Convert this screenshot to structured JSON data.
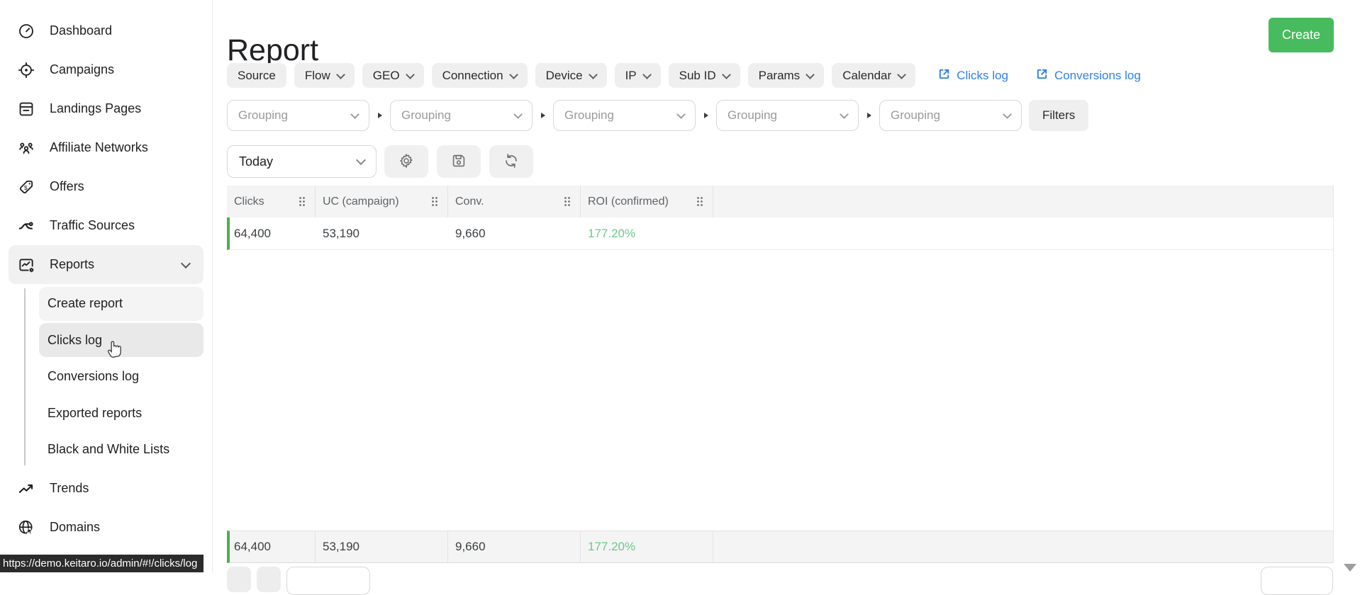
{
  "app": {
    "accent_green": "#47bb5e",
    "link_blue": "#2e80ec",
    "roi_green": "#6dc98a",
    "row_marker_green": "#4caf50"
  },
  "sidebar": {
    "items": [
      {
        "label": "Dashboard",
        "icon": "dashboard-gauge-icon"
      },
      {
        "label": "Campaigns",
        "icon": "target-icon"
      },
      {
        "label": "Landings Pages",
        "icon": "document-icon"
      },
      {
        "label": "Affiliate Networks",
        "icon": "people-icon"
      },
      {
        "label": "Offers",
        "icon": "price-tag-icon"
      },
      {
        "label": "Traffic Sources",
        "icon": "branch-icon"
      },
      {
        "label": "Reports",
        "icon": "report-chart-gear-icon",
        "expanded": true
      },
      {
        "label": "Trends",
        "icon": "trending-up-icon"
      },
      {
        "label": "Domains",
        "icon": "globe-cursor-icon"
      }
    ],
    "reports_children": [
      {
        "label": "Create report",
        "selected": true
      },
      {
        "label": "Clicks log",
        "hovered": true
      },
      {
        "label": "Conversions log"
      },
      {
        "label": "Exported reports"
      },
      {
        "label": "Black and White Lists"
      }
    ]
  },
  "header": {
    "title": "Report",
    "create_button": "Create"
  },
  "filter_bar": {
    "chips": [
      {
        "label": "Source",
        "chevron": false
      },
      {
        "label": "Flow",
        "chevron": true
      },
      {
        "label": "GEO",
        "chevron": true
      },
      {
        "label": "Connection",
        "chevron": true
      },
      {
        "label": "Device",
        "chevron": true
      },
      {
        "label": "IP",
        "chevron": true
      },
      {
        "label": "Sub ID",
        "chevron": true
      },
      {
        "label": "Params",
        "chevron": true
      },
      {
        "label": "Calendar",
        "chevron": true
      }
    ],
    "links": [
      {
        "label": "Clicks log",
        "icon": "external-link-icon"
      },
      {
        "label": "Conversions log",
        "icon": "external-link-icon"
      }
    ]
  },
  "grouping_bar": {
    "groupings": [
      {
        "placeholder": "Grouping"
      },
      {
        "placeholder": "Grouping"
      },
      {
        "placeholder": "Grouping"
      },
      {
        "placeholder": "Grouping"
      },
      {
        "placeholder": "Grouping"
      }
    ],
    "filters_button": "Filters"
  },
  "toolbar": {
    "date_range": "Today",
    "buttons": [
      {
        "icon": "gear-icon"
      },
      {
        "icon": "save-icon"
      },
      {
        "icon": "refresh-icon"
      }
    ]
  },
  "report_table": {
    "columns": [
      "Clicks",
      "UC (campaign)",
      "Conv.",
      "ROI (confirmed)"
    ],
    "rows": [
      [
        "64,400",
        "53,190",
        "9,660",
        "177.20%"
      ]
    ],
    "totals": [
      "64,400",
      "53,190",
      "9,660",
      "177.20%"
    ]
  },
  "status_bar": {
    "url": "https://demo.keitaro.io/admin/#!/clicks/log"
  }
}
